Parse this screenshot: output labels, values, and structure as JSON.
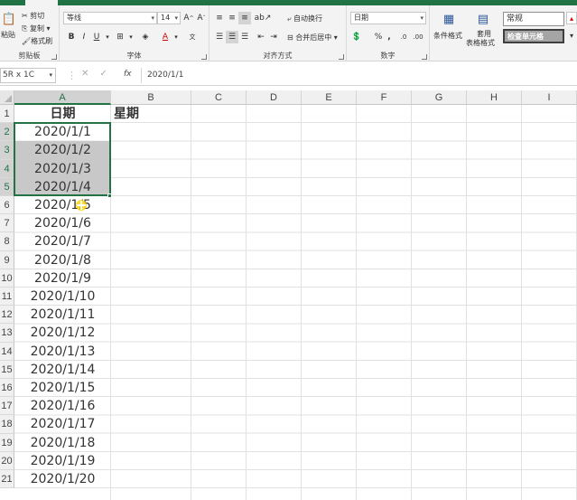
{
  "clipboard": {
    "paste_label": "粘贴",
    "cut_label": "剪切",
    "copy_label": "复制",
    "format_painter_label": "格式刷",
    "group_label": "剪贴板"
  },
  "font": {
    "font_name": "等线",
    "font_size": "14",
    "bold": "B",
    "italic": "I",
    "underline": "U",
    "group_label": "字体"
  },
  "alignment": {
    "wrap_text_label": "自动换行",
    "merge_center_label": "合并后居中",
    "group_label": "对齐方式"
  },
  "number": {
    "format_value": "日期",
    "percent": "%",
    "comma": ",",
    "group_label": "数字"
  },
  "styles": {
    "conditional_format_label": "条件格式",
    "table_format_line1": "套用",
    "table_format_line2": "表格格式",
    "normal_style": "常规",
    "check_cell_style": "检查单元格"
  },
  "formula_bar": {
    "name_box": "5R x 1C",
    "fx": "fx",
    "content": "2020/1/1"
  },
  "columns": [
    "A",
    "B",
    "C",
    "D",
    "E",
    "F",
    "G",
    "H",
    "I"
  ],
  "rows": [
    "1",
    "2",
    "3",
    "4",
    "5",
    "6",
    "7",
    "8",
    "9",
    "10",
    "11",
    "12",
    "13",
    "14",
    "15",
    "16",
    "17",
    "18",
    "19",
    "20",
    "21"
  ],
  "cells": {
    "A1": "日期",
    "B1": "星期"
  },
  "dates": [
    "2020/1/1",
    "2020/1/2",
    "2020/1/3",
    "2020/1/4",
    "2020/1/5",
    "2020/1/6",
    "2020/1/7",
    "2020/1/8",
    "2020/1/9",
    "2020/1/10",
    "2020/1/11",
    "2020/1/12",
    "2020/1/13",
    "2020/1/14",
    "2020/1/15",
    "2020/1/16",
    "2020/1/17",
    "2020/1/18",
    "2020/1/19",
    "2020/1/20"
  ],
  "colors": {
    "accent": "#217346",
    "selection": "#c8c8c8"
  }
}
